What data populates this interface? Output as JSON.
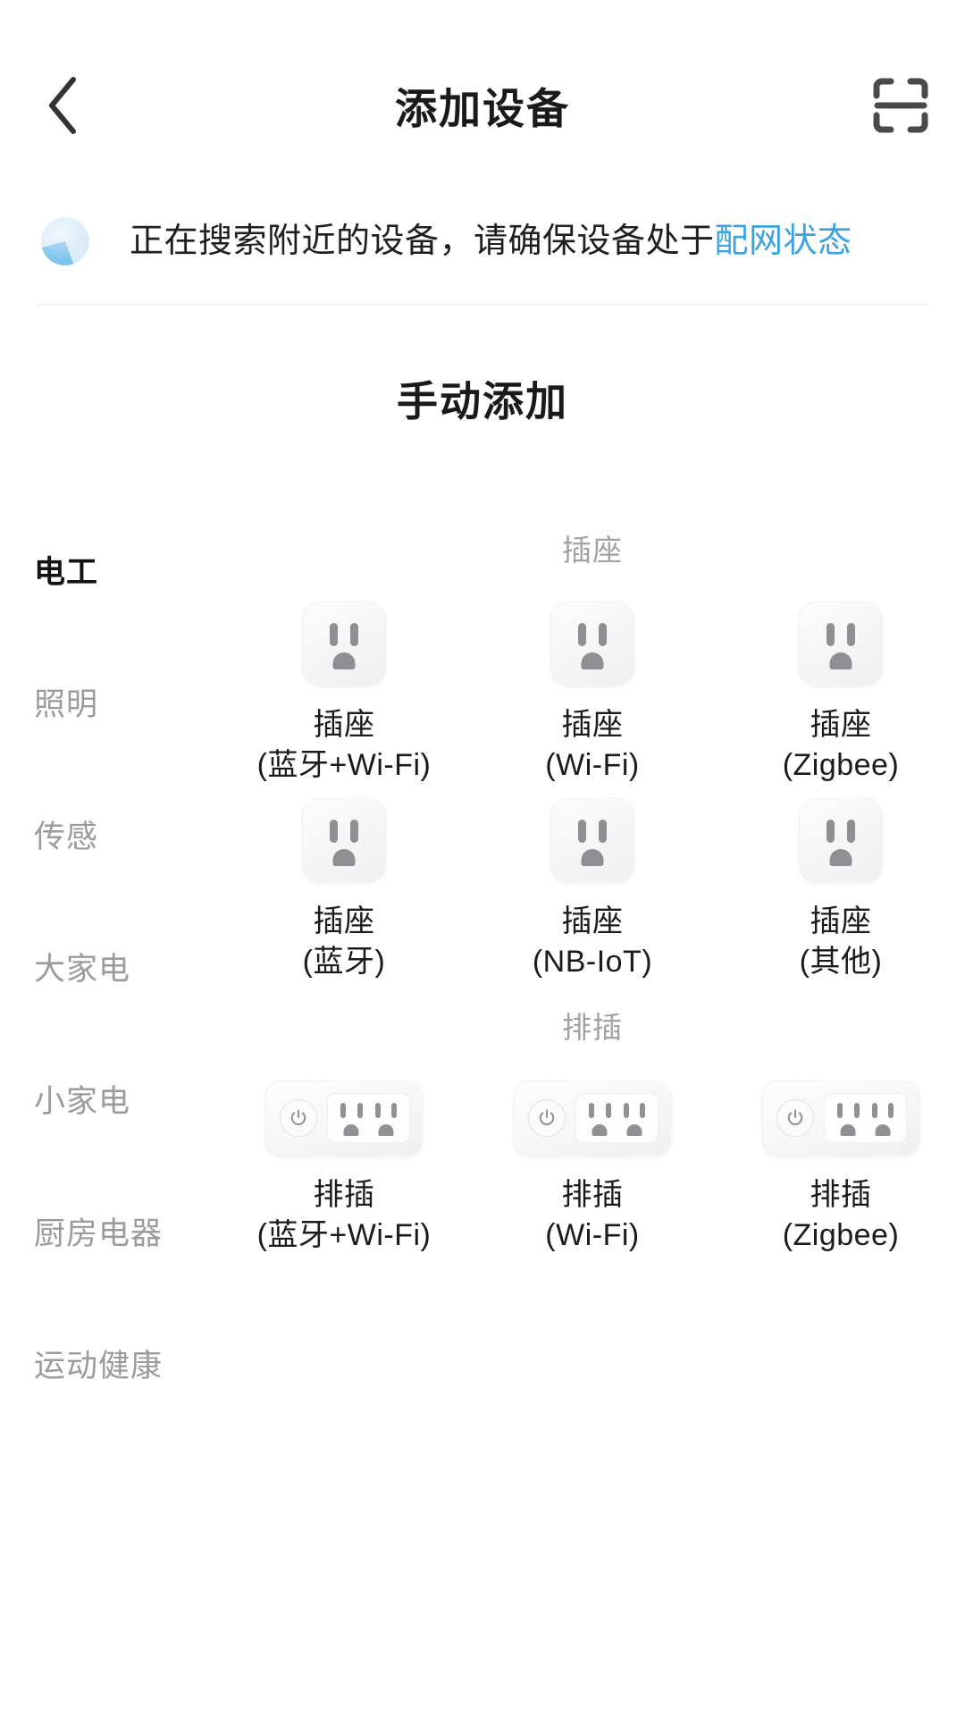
{
  "header": {
    "back_icon": "chevron-left-icon",
    "title": "添加设备",
    "scan_icon": "scan-qr-icon"
  },
  "status": {
    "spinner_icon": "loading-spinner-icon",
    "text": "正在搜索附近的设备，请确保设备处于",
    "link_text": "配网状态",
    "link_color": "#3da2e0"
  },
  "manual_add": {
    "title": "手动添加"
  },
  "sidebar": {
    "items": [
      {
        "label": "电工",
        "active": true
      },
      {
        "label": "照明",
        "active": false
      },
      {
        "label": "传感",
        "active": false
      },
      {
        "label": "大家电",
        "active": false
      },
      {
        "label": "小家电",
        "active": false
      },
      {
        "label": "厨房电器",
        "active": false
      },
      {
        "label": "运动健康",
        "active": false
      }
    ]
  },
  "catalog": {
    "groups": [
      {
        "title": "插座",
        "icon": "wall-socket-icon",
        "items": [
          {
            "name": "插座",
            "variant": "(蓝牙+Wi-Fi)"
          },
          {
            "name": "插座",
            "variant": "(Wi-Fi)"
          },
          {
            "name": "插座",
            "variant": "(Zigbee)"
          },
          {
            "name": "插座",
            "variant": "(蓝牙)"
          },
          {
            "name": "插座",
            "variant": "(NB-IoT)"
          },
          {
            "name": "插座",
            "variant": "(其他)"
          }
        ]
      },
      {
        "title": "排插",
        "icon": "power-strip-icon",
        "items": [
          {
            "name": "排插",
            "variant": "(蓝牙+Wi-Fi)"
          },
          {
            "name": "排插",
            "variant": "(Wi-Fi)"
          },
          {
            "name": "排插",
            "variant": "(Zigbee)"
          }
        ]
      }
    ]
  }
}
